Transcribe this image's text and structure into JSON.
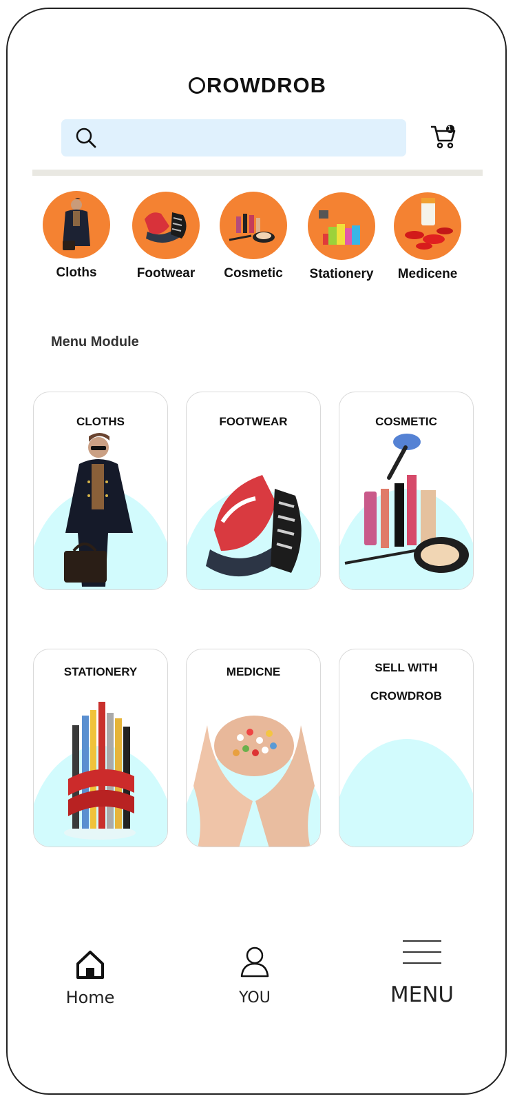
{
  "header": {
    "logo_text": "ROWDROB"
  },
  "search": {
    "placeholder": "",
    "value": ""
  },
  "cart": {
    "badge": "1"
  },
  "categories": [
    {
      "label": "Cloths"
    },
    {
      "label": "Footwear"
    },
    {
      "label": "Cosmetic"
    },
    {
      "label": "Stationery"
    },
    {
      "label": "Medicene"
    }
  ],
  "menu_module": {
    "title": "Menu Module",
    "cards": [
      {
        "title": "CLOTHS"
      },
      {
        "title": "FOOTWEAR"
      },
      {
        "title": "COSMETIC"
      },
      {
        "title": "STATIONERY"
      },
      {
        "title": "MEDICNE"
      },
      {
        "title_line1": "SELL WITH",
        "title_line2": "CROWDROB"
      }
    ]
  },
  "bottom_nav": {
    "home": "Home",
    "you": "YOU",
    "menu": "MENU"
  },
  "colors": {
    "accent_orange": "#f48232",
    "search_bg": "#e0f1fd",
    "card_blob": "#d2fbfd"
  }
}
